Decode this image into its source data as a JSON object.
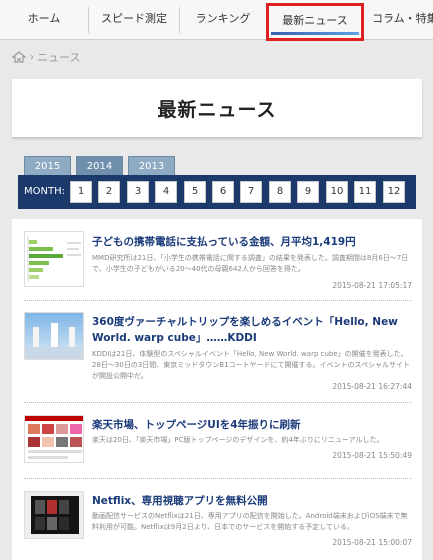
{
  "nav": {
    "items": [
      {
        "label": "ホーム"
      },
      {
        "label": "スピード測定"
      },
      {
        "label": "ランキング"
      },
      {
        "label": "最新ニュース"
      },
      {
        "label": "コラム・特集"
      }
    ]
  },
  "breadcrumb": {
    "current": "ニュース"
  },
  "page_title": "最新ニュース",
  "year_tabs": [
    "2015",
    "2014",
    "2013"
  ],
  "month_label": "MONTH:",
  "months": [
    "1",
    "2",
    "3",
    "4",
    "5",
    "6",
    "7",
    "8",
    "9",
    "10",
    "11",
    "12"
  ],
  "articles": [
    {
      "title": "子どもの携帯電話に支払っている金額、月平均1,419円",
      "body": "MMD研究所は21日、「小学生の携帯電話に関する調査」の結果を発表した。調査期間は8月6日～7日で、小学生の子どもがいる20～40代の母親642人から回答を得た。",
      "date": "2015-08-21 17:05:17"
    },
    {
      "title": "360度ヴァーチャルトリップを楽しめるイベント「Hello, New World. warp cube」……KDDI",
      "body": "KDDIは21日、体験型のスペシャルイベント「Hello, New World. warp cube」の開催を発表した。28日～30日の3日間、東京ミッドタウンB1コートヤードにて開催する。イベントのスペシャルサイトが開設公開中だ。",
      "date": "2015-08-21 16:27:44"
    },
    {
      "title": "楽天市場、トップページUIを4年振りに刷新",
      "body": "楽天は20日、「楽天市場」PC版トップページのデザインを、約4年ぶりにリニューアルした。",
      "date": "2015-08-21 15:50:49"
    },
    {
      "title": "Netflix、専用視聴アプリを無料公開",
      "body": "動画配信サービスのNetflixは21日、専用アプリの配信を開始した。Android端末およびiOS端末で無料利用が可能。Netflixは9月2日より、日本でのサービスを開始する予定している。",
      "date": "2015-08-21 15:00:07"
    }
  ]
}
